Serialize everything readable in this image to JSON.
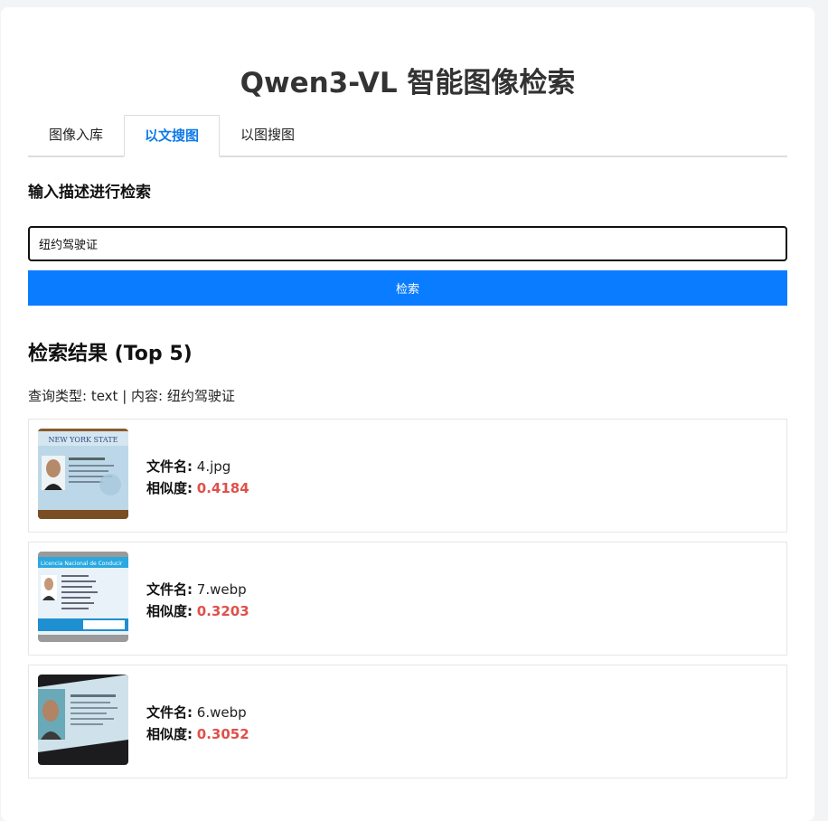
{
  "app": {
    "title": "Qwen3-VL 智能图像检索"
  },
  "tabs": [
    {
      "label": "图像入库"
    },
    {
      "label": "以文搜图"
    },
    {
      "label": "以图搜图"
    }
  ],
  "search": {
    "section_label": "输入描述进行检索",
    "value": "纽约驾驶证",
    "button_label": "检索"
  },
  "results": {
    "title": "检索结果 (Top 5)",
    "query_info": "查询类型: text | 内容: 纽约驾驶证",
    "filename_label": "文件名:",
    "similarity_label": "相似度:",
    "items": [
      {
        "filename": "4.jpg",
        "similarity": "0.4184"
      },
      {
        "filename": "7.webp",
        "similarity": "0.3203"
      },
      {
        "filename": "6.webp",
        "similarity": "0.3052"
      }
    ]
  },
  "thumbnails": {
    "item0_header_text": "NEW YORK STATE",
    "item1_header_text": "Licencia Nacional de Conducir"
  }
}
